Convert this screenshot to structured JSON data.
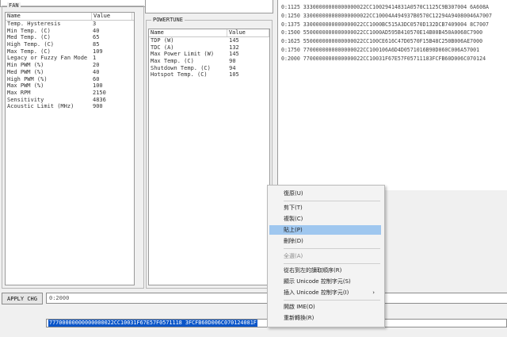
{
  "fan": {
    "title": "FAN",
    "columns": [
      "Name",
      "Value"
    ],
    "rows": [
      [
        "Temp. Hysteresis",
        "3"
      ],
      [
        "Min Temp. (C)",
        "40"
      ],
      [
        "Med Temp. (C)",
        "65"
      ],
      [
        "High Temp. (C)",
        "85"
      ],
      [
        "Max Temp. (C)",
        "109"
      ],
      [
        "Legacy or Fuzzy Fan Mode",
        "1"
      ],
      [
        "Min PWM (%)",
        "20"
      ],
      [
        "Med PWM (%)",
        "40"
      ],
      [
        "High PWM (%)",
        "60"
      ],
      [
        "Max PWM (%)",
        "100"
      ],
      [
        "Max RPM",
        "2150"
      ],
      [
        "Sensitivity",
        "4836"
      ],
      [
        "Acoustic Limit (MHz)",
        "900"
      ]
    ]
  },
  "powertune": {
    "title": "POWERTUNE",
    "columns": [
      "Name",
      "Value"
    ],
    "rows": [
      [
        "TDP (W)",
        "145"
      ],
      [
        "TDC (A)",
        "132"
      ],
      [
        "Max Power Limit (W)",
        "145"
      ],
      [
        "Max Temp. (C)",
        "90"
      ],
      [
        "Shutdown Temp. (C)",
        "94"
      ],
      [
        "Hotspot Temp. (C)",
        "105"
      ]
    ]
  },
  "hex_table": [
    "0:1125  33300000000000000022CC10029414831A0570C1125C9B307004 6A608A",
    "0:1250  330000000000000000022CC10004A494937B0570C12294A94080046A7007",
    "0:1375  3300000000000000022CC1000BC515A3DC0570D132DCB7409004 8C7007",
    "0:1500  5500000000000000022CC1000AD595B410570E14B00B450A0068C7900",
    "0:1625  5500000000000000022CC100CE616C47D0570F15B48C250B006AE7000",
    "0:1750  7700000000000000022CC100106A6D4D0571016B90D060C006A57001",
    "0:2000  7700000000000000022CC10031F67E57F05711183FCFB60D006C070124"
  ],
  "bottom": {
    "apply_label": "APPLY CHG",
    "address_value": "0:2000",
    "hex_value": "77700000000000000022CC10031F67E57F0571118 3FCFB60D006C070124081F"
  },
  "context_menu": {
    "items": [
      {
        "label": "復原(U)",
        "disabled": false
      },
      {
        "label": "剪下(T)",
        "disabled": false
      },
      {
        "label": "複製(C)",
        "disabled": false
      },
      {
        "label": "貼上(P)",
        "disabled": false,
        "highlighted": true
      },
      {
        "label": "刪除(D)",
        "disabled": false
      },
      {
        "label": "全選(A)",
        "disabled": true
      },
      {
        "label": "從右到左的讀取順序(R)",
        "disabled": false
      },
      {
        "label": "顯示 Unicode 控制字元(S)",
        "disabled": false
      },
      {
        "label": "插入 Unicode 控制字元(I)",
        "disabled": false,
        "submenu": true
      },
      {
        "label": "開啟 IME(O)",
        "disabled": false
      },
      {
        "label": "重新轉換(R)",
        "disabled": false
      }
    ],
    "submenu_arrow": "›"
  }
}
